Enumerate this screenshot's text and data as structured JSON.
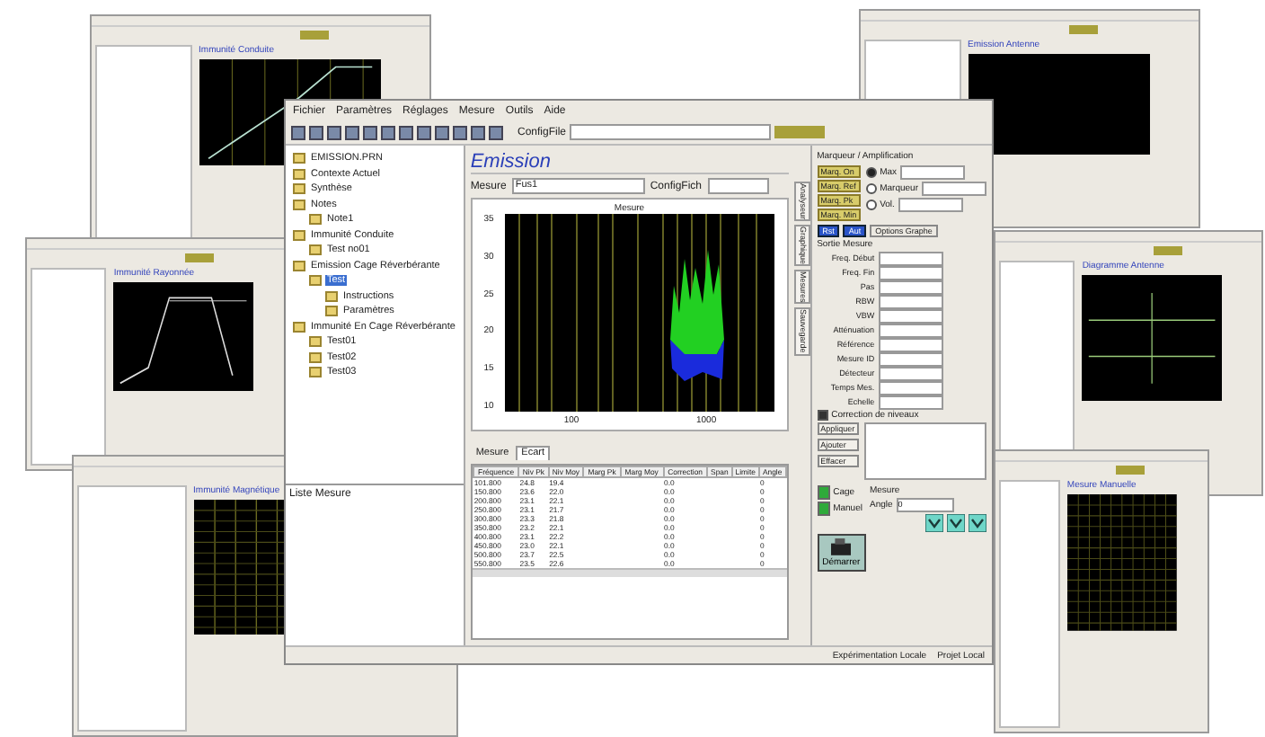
{
  "background_windows": [
    {
      "title": "Immunité Conduite",
      "kind": "ramp"
    },
    {
      "title": "Immunité Rayonnée",
      "kind": "trapezoid"
    },
    {
      "title": "Immunité Magnétique",
      "kind": "grid"
    },
    {
      "title": "Emission Antenne",
      "kind": "blank"
    },
    {
      "title": "Diagramme Antenne",
      "kind": "cross"
    },
    {
      "title": "Mesure Manuelle",
      "kind": "grid"
    }
  ],
  "main": {
    "menu": [
      "Fichier",
      "Paramètres",
      "Réglages",
      "Mesure",
      "Outils",
      "Aide"
    ],
    "toolbar_field_label": "ConfigFile",
    "tree": [
      {
        "label": "EMISSION.PRN",
        "selected": false
      },
      {
        "label": "Contexte Actuel",
        "selected": false
      },
      {
        "label": "Synthèse",
        "selected": false
      },
      {
        "label": "Notes",
        "selected": false,
        "children": [
          {
            "label": "Note1",
            "selected": false
          }
        ]
      },
      {
        "label": "Immunité Conduite",
        "selected": false,
        "children": [
          {
            "label": "Test no01",
            "selected": false
          }
        ]
      },
      {
        "label": "Emission Cage Réverbérante",
        "selected": false,
        "children": [
          {
            "label": "Test",
            "selected": true,
            "children": [
              {
                "label": "Instructions",
                "selected": false
              },
              {
                "label": "Paramètres",
                "selected": false
              }
            ]
          }
        ]
      },
      {
        "label": "Immunité En Cage Réverbérante",
        "selected": false,
        "children": [
          {
            "label": "Test01",
            "selected": false
          },
          {
            "label": "Test02",
            "selected": false
          },
          {
            "label": "Test03",
            "selected": false
          }
        ]
      }
    ],
    "tree_footer": "Liste Mesure",
    "title": "Emission",
    "measure_label": "Mesure",
    "measure_value": "Fus1",
    "config_label": "ConfigFich",
    "chart_title": "Mesure",
    "yticks": [
      "35",
      "30",
      "25",
      "20",
      "15",
      "10"
    ],
    "xticks": [
      "100",
      "1000"
    ],
    "table_tabs": [
      {
        "label": "Mesure",
        "selected": false
      },
      {
        "label": "Ecart",
        "selected": true
      }
    ],
    "columns": [
      "Fréquence",
      "Niv Pk",
      "Niv Moy",
      "Marg Pk",
      "Marg Moy",
      "Correction",
      "Span",
      "Limite",
      "Angle"
    ],
    "rows": [
      [
        "101.800",
        "24.8",
        "19.4",
        "",
        "",
        "0.0",
        "",
        "",
        "0"
      ],
      [
        "150.800",
        "23.6",
        "22.0",
        "",
        "",
        "0.0",
        "",
        "",
        "0"
      ],
      [
        "200.800",
        "23.1",
        "22.1",
        "",
        "",
        "0.0",
        "",
        "",
        "0"
      ],
      [
        "250.800",
        "23.1",
        "21.7",
        "",
        "",
        "0.0",
        "",
        "",
        "0"
      ],
      [
        "300.800",
        "23.3",
        "21.8",
        "",
        "",
        "0.0",
        "",
        "",
        "0"
      ],
      [
        "350.800",
        "23.2",
        "22.1",
        "",
        "",
        "0.0",
        "",
        "",
        "0"
      ],
      [
        "400.800",
        "23.1",
        "22.2",
        "",
        "",
        "0.0",
        "",
        "",
        "0"
      ],
      [
        "450.800",
        "23.0",
        "22.1",
        "",
        "",
        "0.0",
        "",
        "",
        "0"
      ],
      [
        "500.800",
        "23.7",
        "22.5",
        "",
        "",
        "0.0",
        "",
        "",
        "0"
      ],
      [
        "550.800",
        "23.5",
        "22.6",
        "",
        "",
        "0.0",
        "",
        "",
        "0"
      ]
    ],
    "side_tabs": [
      "Analyseur",
      "Graphique",
      "Mesures",
      "Sauvegarde"
    ],
    "marker_group": "Marqueur / Amplification",
    "marker_buttons": [
      "Marq. On",
      "Marq. Ref",
      "Marq. Pk",
      "Marq. Min"
    ],
    "marker_radios": [
      {
        "label": "Max",
        "selected": true
      },
      {
        "label": "Marqueur",
        "selected": false
      },
      {
        "label": "Vol.",
        "selected": false
      }
    ],
    "blue_buttons": [
      "Rst",
      "Aut"
    ],
    "graph_options": "Options Graphe",
    "settings_group": "Sortie Mesure",
    "settings": [
      "Freq. Début",
      "Freq. Fin",
      "Pas",
      "RBW",
      "VBW",
      "Atténuation",
      "Référence",
      "Mesure ID",
      "Détecteur",
      "Temps Mes.",
      "Echelle"
    ],
    "correction": {
      "label": "Correction de niveaux",
      "checked": true
    },
    "action_buttons": [
      "Appliquer",
      "Ajouter",
      "Effacer"
    ],
    "leds": [
      {
        "label": "Cage",
        "on": true
      },
      {
        "label": "Manuel",
        "on": true
      }
    ],
    "mesure_group": "Mesure",
    "angle_label": "Angle",
    "angle_value": "0",
    "start_button": "Démarrer",
    "status": [
      "Expérimentation Locale",
      "Projet Local"
    ]
  }
}
